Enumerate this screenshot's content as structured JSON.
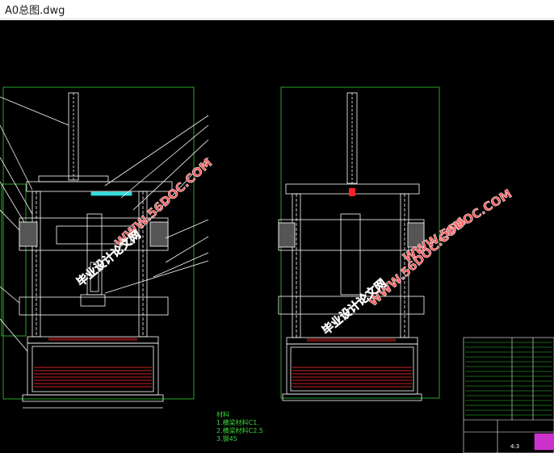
{
  "window": {
    "title": "A0总图.dwg"
  },
  "watermarks": {
    "site_left": "WWW.56DOC.COM",
    "site_mid": "WWW.56DOC.COM",
    "site_right": "WWW.56DOC.COM",
    "cn_left": "毕业设计论文网",
    "cn_right": "毕业设计论文网"
  },
  "notes": {
    "heading": "材料",
    "items": [
      "1.横梁材料C1.",
      "2.横梁材料C2.5",
      "3.钢45"
    ]
  },
  "title_block": {
    "scale": "4:3"
  },
  "colors": {
    "background": "#000000",
    "outline": "#ffffff",
    "frame": "#33cc33",
    "hatch": "#cc2222",
    "accent": "#33dddd",
    "watermark": "#ff5a5a"
  }
}
